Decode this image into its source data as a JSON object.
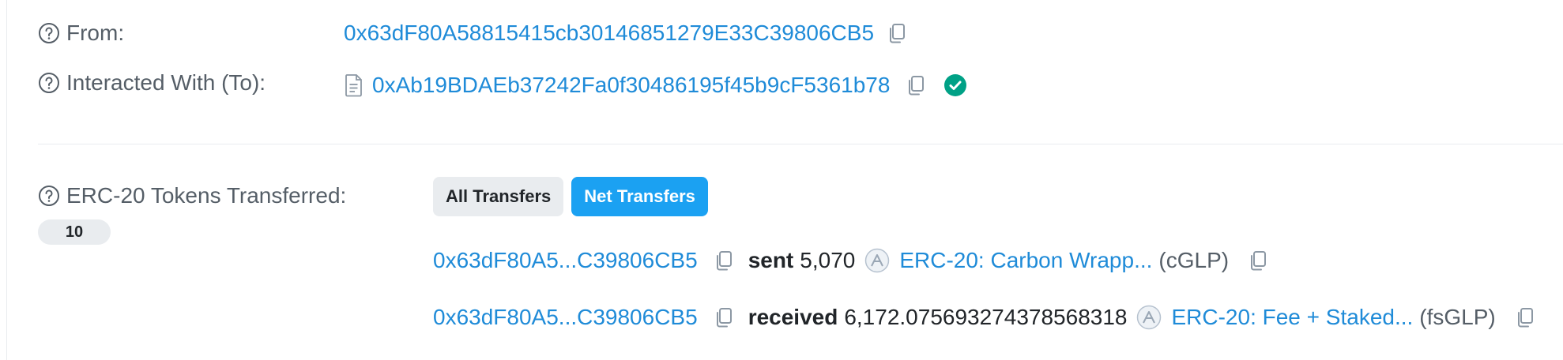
{
  "from": {
    "label": "From:",
    "address": "0x63dF80A58815415cb30146851279E33C39806CB5"
  },
  "interacted": {
    "label": "Interacted With (To):",
    "address": "0xAb19BDAEb37242Fa0f30486195f45b9cF5361b78",
    "verified": true
  },
  "tokens": {
    "label": "ERC-20 Tokens Transferred:",
    "count": "10",
    "tabs": [
      {
        "label": "All Transfers",
        "active": false
      },
      {
        "label": "Net Transfers",
        "active": true
      }
    ],
    "transfers": [
      {
        "address": "0x63dF80A5...C39806CB5",
        "action": "sent",
        "amount": "5,070",
        "token_name": "ERC-20: Carbon Wrapp...",
        "token_symbol": "(cGLP)"
      },
      {
        "address": "0x63dF80A5...C39806CB5",
        "action": "received",
        "amount": "6,172.075693274378568318",
        "token_name": "ERC-20: Fee + Staked...",
        "token_symbol": "(fsGLP)"
      }
    ]
  },
  "colors": {
    "link": "#1f8bd8",
    "active_tab": "#1ba1f2",
    "verified_badge": "#00a186"
  }
}
